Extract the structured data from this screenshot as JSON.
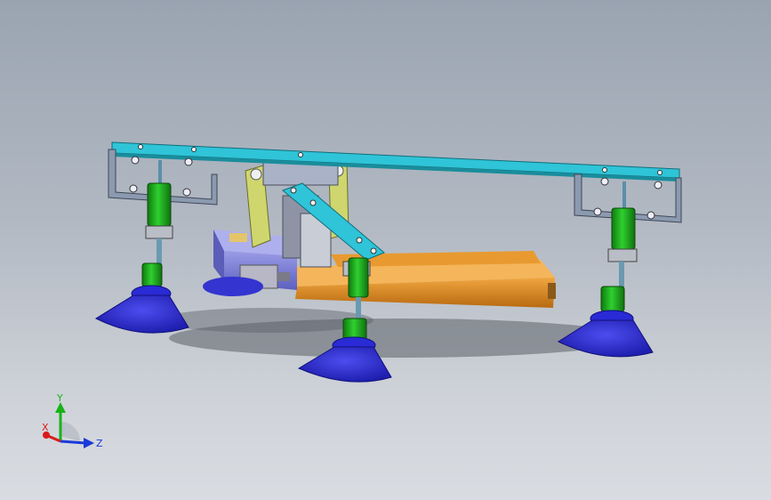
{
  "view": {
    "background_top": "#9aa4b1",
    "background_bottom": "#d9dce1"
  },
  "colors": {
    "frame_bar": "#2fc4d8",
    "bracket": "#7e8ea6",
    "cylinder": "#1fa51f",
    "suction_cup": "#2a2ad6",
    "side_plate": "#c8cf6a",
    "actuator_block": "#7e80d6",
    "rail": "#d98a1e",
    "axis_x": "#d81b1b",
    "axis_y": "#17b317",
    "axis_z": "#1a3ad9"
  },
  "triad": {
    "y_label": "Y",
    "x_label": "X",
    "z_label": "Z"
  }
}
